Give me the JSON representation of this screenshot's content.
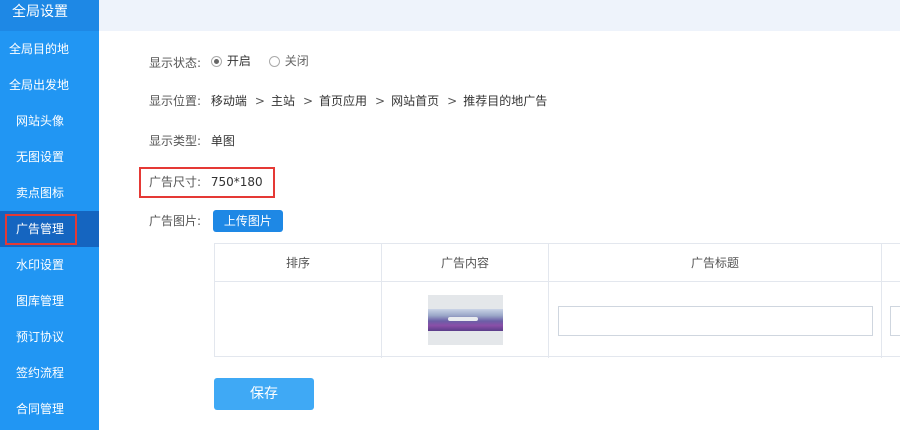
{
  "sidebar": {
    "title": "全局设置",
    "items": [
      {
        "label": "全局目的地"
      },
      {
        "label": "全局出发地"
      },
      {
        "label": "网站头像"
      },
      {
        "label": "无图设置"
      },
      {
        "label": "卖点图标"
      },
      {
        "label": "广告管理"
      },
      {
        "label": "水印设置"
      },
      {
        "label": "图库管理"
      },
      {
        "label": "预订协议"
      },
      {
        "label": "签约流程"
      },
      {
        "label": "合同管理"
      }
    ]
  },
  "form": {
    "status": {
      "label": "显示状态:",
      "options": [
        {
          "label": "开启",
          "checked": true
        },
        {
          "label": "关闭",
          "checked": false
        }
      ]
    },
    "position": {
      "label": "显示位置:",
      "crumbs": [
        "移动端",
        "主站",
        "首页应用",
        "网站首页",
        "推荐目的地广告"
      ],
      "separator": ">"
    },
    "type": {
      "label": "显示类型:",
      "value": "单图"
    },
    "size": {
      "label": "广告尺寸:",
      "value": "750*180"
    },
    "image": {
      "label": "广告图片:",
      "upload_label": "上传图片"
    }
  },
  "table": {
    "headers": [
      "排序",
      "广告内容",
      "广告标题"
    ],
    "rows": [
      {
        "sort": "",
        "content": "ad-thumbnail",
        "title": ""
      }
    ]
  },
  "save_label": "保存",
  "colors": {
    "sidebar": "#2196f3",
    "active": "#1565c0",
    "highlight": "#e53935",
    "primary": "#1e88e5",
    "save": "#3fa9f5"
  }
}
